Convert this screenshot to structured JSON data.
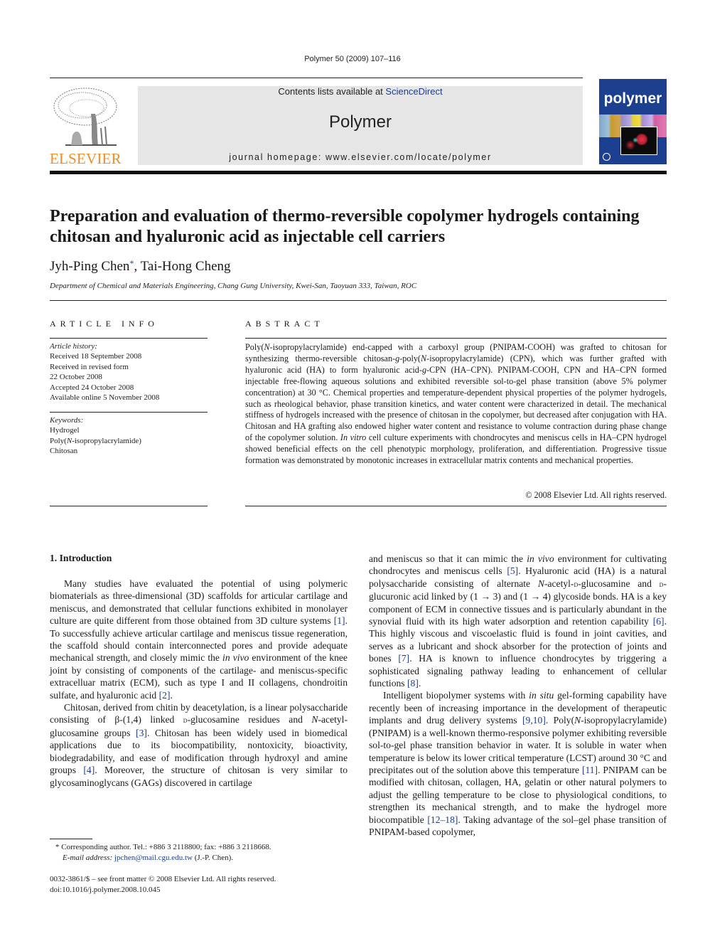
{
  "running_head": "Polymer 50 (2009) 107–116",
  "header": {
    "publisher_logo_text": "ELSEVIER",
    "contents_prefix": "Contents lists available at ",
    "contents_link": "ScienceDirect",
    "journal_name": "Polymer",
    "homepage": "journal homepage: www.elsevier.com/locate/polymer",
    "cover_title": "polymer",
    "colors": {
      "elsevier_orange": "#f28c28",
      "link_blue": "#1f3c8c",
      "cover_blue": "#1d3f8f",
      "header_gray": "#e6e6e6"
    }
  },
  "article": {
    "title_line1": "Preparation and evaluation of thermo-reversible copolymer hydrogels containing",
    "title_line2": "chitosan and hyaluronic acid as injectable cell carriers",
    "author1": "Jyh-Ping Chen",
    "author1_mark": "*",
    "author_sep": ", ",
    "author2": "Tai-Hong Cheng",
    "affiliation": "Department of Chemical and Materials Engineering, Chang Gung University, Kwei-San, Taoyuan 333, Taiwan, ROC"
  },
  "article_info": {
    "label": "ARTICLE INFO",
    "history_label": "Article history:",
    "history": [
      "Received 18 September 2008",
      "Received in revised form",
      "22 October 2008",
      "Accepted 24 October 2008",
      "Available online 5 November 2008"
    ],
    "keywords_label": "Keywords:",
    "keywords": [
      "Hydrogel",
      "Poly(",
      "N",
      "-isopropylacrylamide)",
      "Chitosan"
    ]
  },
  "abstract": {
    "label": "ABSTRACT",
    "p1": "Poly(",
    "p1_i": "N",
    "p2": "-isopropylacrylamide) end-capped with a carboxyl group (PNIPAM-COOH) was grafted to chitosan for synthesizing thermo-reversible chitosan-",
    "p2_i": "g",
    "p3": "-poly(",
    "p3_i": "N",
    "p4": "-isopropylacrylamide) (CPN), which was further grafted with hyaluronic acid (HA) to form hyaluronic acid-",
    "p4_i": "g",
    "p5": "-CPN (HA–CPN). PNIPAM-COOH, CPN and HA–CPN formed injectable free-flowing aqueous solutions and exhibited reversible sol-to-gel phase transition (above 5% polymer concentration) at 30 °C. Chemical properties and temperature-dependent physical properties of the polymer hydrogels, such as rheological behavior, phase transition kinetics, and water content were characterized in detail. The mechanical stiffness of hydrogels increased with the presence of chitosan in the copolymer, but decreased after conjugation with HA. Chitosan and HA grafting also endowed higher water content and resistance to volume contraction during phase change of the copolymer solution. ",
    "p5_i": "In vitro",
    "p6": " cell culture experiments with chondrocytes and meniscus cells in HA–CPN hydrogel showed beneficial effects on the cell phenotypic morphology, proliferation, and differentiation. Progressive tissue formation was demonstrated by monotonic increases in extracellular matrix contents and mechanical properties.",
    "copyright": "© 2008 Elsevier Ltd. All rights reserved."
  },
  "intro": {
    "heading": "1.  Introduction",
    "left": {
      "a1": "Many studies have evaluated the potential of using polymeric biomaterials as three-dimensional (3D) scaffolds for articular cartilage and meniscus, and demonstrated that cellular functions exhibited in monolayer culture are quite different from those obtained from 3D culture systems ",
      "r1": "[1]",
      "a2": ". To successfully achieve articular cartilage and meniscus tissue regeneration, the scaffold should contain interconnected pores and provide adequate mechanical strength, and closely mimic the ",
      "i1": "in vivo",
      "a3": " environment of the knee joint by consisting of components of the cartilage- and meniscus-specific extracelluar matrix (ECM), such as type I and II collagens, chondroitin sulfate, and hyaluronic acid ",
      "r2": "[2]",
      "a4": ".",
      "b1": "Chitosan, derived from chitin by deacetylation, is a linear polysaccharide consisting of β-(1,4) linked ",
      "b_sc": "d",
      "b2": "-glucosamine residues and ",
      "b_i": "N",
      "b3": "-acetyl-glucosamine groups ",
      "r3": "[3]",
      "b4": ". Chitosan has been widely used in biomedical applications due to its biocompatibility, nontoxicity, bioactivity, biodegradability, and ease of modification through hydroxyl and amine groups ",
      "r4": "[4]",
      "b5": ". Moreover, the structure of chitosan is very similar to glycosaminoglycans (GAGs) discovered in cartilage"
    },
    "right": {
      "c1": "and meniscus so that it can mimic the ",
      "c_i": "in vivo",
      "c2": " environment for cultivating chondrocytes and meniscus cells ",
      "r5": "[5]",
      "c3": ". Hyaluronic acid (HA) is a natural polysaccharide consisting of alternate ",
      "c_i2": "N",
      "c4": "-acetyl-",
      "c_sc1": "d",
      "c5": "-glucosamine and ",
      "c_sc2": "d",
      "c6": "-glucuronic acid linked by (1 → 3) and (1 → 4) glycoside bonds. HA is a key component of ECM in connective tissues and is particularly abundant in the synovial fluid with its high water adsorption and retention capability ",
      "r6": "[6]",
      "c7": ". This highly viscous and viscoelastic fluid is found in joint cavities, and serves as a lubricant and shock absorber for the protection of joints and bones ",
      "r7": "[7]",
      "c8": ". HA is known to influence chondrocytes by triggering a sophisticated signaling pathway leading to enhancement of cellular functions ",
      "r8": "[8]",
      "c9": ".",
      "d1": "Intelligent biopolymer systems with ",
      "d_i": "in situ",
      "d2": " gel-forming capability have recently been of increasing importance in the development of therapeutic implants and drug delivery systems ",
      "r9": "[9,10]",
      "d3": ". Poly(",
      "d_i2": "N",
      "d4": "-isopropylacrylamide) (PNIPAM) is a well-known thermo-responsive polymer exhibiting reversible sol-to-gel phase transition behavior in water. It is soluble in water when temperature is below its lower critical temperature (LCST) around 30 °C and precipitates out of the solution above this temperature ",
      "r11": "[11]",
      "d5": ". PNIPAM can be modified with chitosan, collagen, HA, gelatin or other natural polymers to adjust the gelling temperature to be close to physiological conditions, to strengthen its mechanical strength, and to make the hydrogel more biocompatible ",
      "r12": "[12–18]",
      "d6": ". Taking advantage of the sol–gel phase transition of PNIPAM-based copolymer,"
    }
  },
  "footnote": {
    "mark": "*",
    "line1": " Corresponding author. Tel.: +886 3 2118800; fax: +886 3 2118668.",
    "email_label": "E-mail address:",
    "email": "jpchen@mail.cgu.edu.tw",
    "email_suffix": " (J.-P. Chen)."
  },
  "front_matter": {
    "issn": "0032-3861/$ – see front matter © 2008 Elsevier Ltd. All rights reserved.",
    "doi": "doi:10.1016/j.polymer.2008.10.045"
  }
}
